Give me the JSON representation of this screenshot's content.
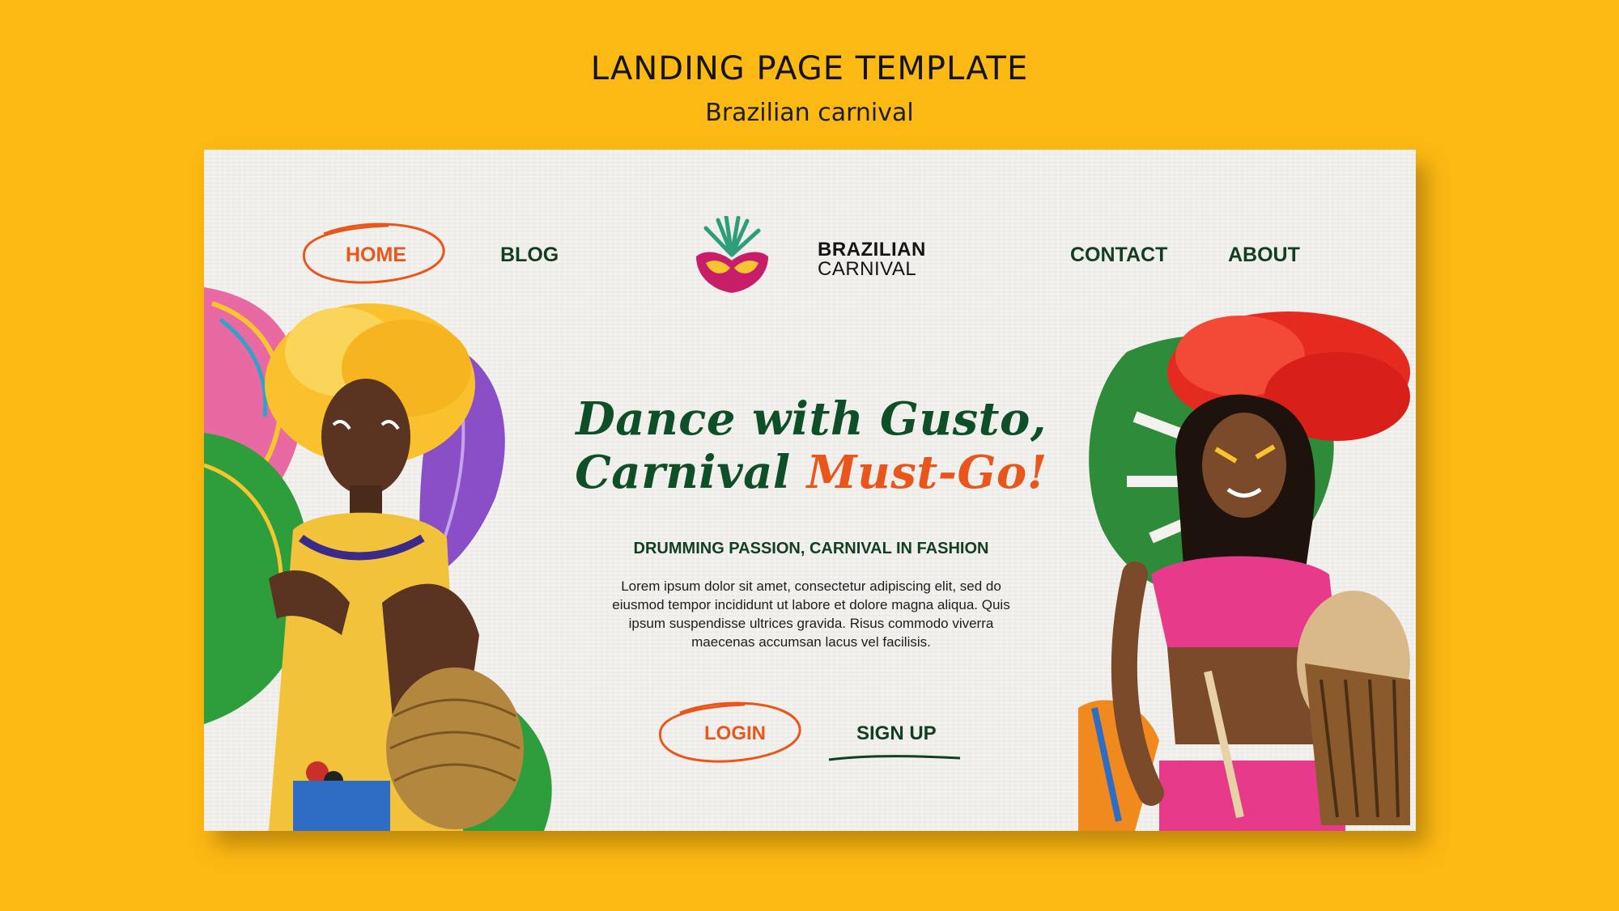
{
  "header": {
    "title": "LANDING PAGE TEMPLATE",
    "subtitle": "Brazilian carnival"
  },
  "nav": {
    "home": "HOME",
    "blog": "BLOG",
    "contact": "CONTACT",
    "about": "ABOUT"
  },
  "logo": {
    "line1": "BRAZILIAN",
    "line2": "CARNIVAL",
    "icon": "carnival-mask-icon"
  },
  "hero": {
    "headline_line1": "Dance with Gusto,",
    "headline_line2_part1": "Carnival ",
    "headline_line2_part2": "Must-Go!",
    "tagline": "DRUMMING PASSION, CARNIVAL IN FASHION",
    "body_line1": "Lorem ipsum dolor sit amet, consectetur adipiscing elit, sed do",
    "body_line2": "eiusmod tempor incididunt ut labore et dolore magna aliqua. Quis",
    "body_line3": "ipsum suspendisse ultrices gravida. Risus commodo viverra",
    "body_line4": "maecenas accumsan lacus vel facilisis."
  },
  "actions": {
    "login": "LOGIN",
    "signup": "SIGN UP"
  },
  "colors": {
    "background": "#FDB913",
    "card": "#F3F2EE",
    "accent_orange": "#E8561B",
    "dark_green": "#123E21"
  }
}
